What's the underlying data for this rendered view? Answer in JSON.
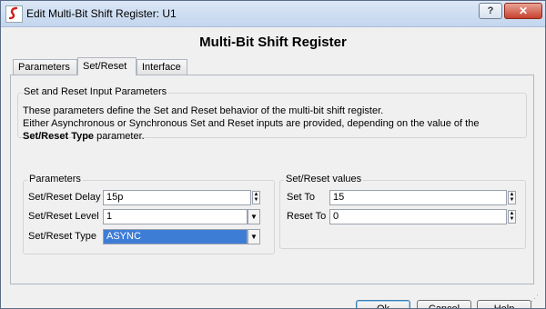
{
  "window": {
    "title": "Edit Multi-Bit Shift Register: U1",
    "help_label": "?",
    "close_label": "✕"
  },
  "heading": "Multi-Bit Shift Register",
  "tabs": [
    "Parameters",
    "Set/Reset",
    "Interface"
  ],
  "active_tab": "Set/Reset",
  "info": {
    "title": "Set and Reset Input Parameters",
    "line1": "These parameters define the Set and Reset behavior of the multi-bit shift register.",
    "line2_prefix": "Either Asynchronous or Synchronous Set and Reset inputs are provided, depending on the value of the ",
    "line2_bold": "Set/Reset Type",
    "line2_suffix": " parameter."
  },
  "parameters": {
    "title": "Parameters",
    "delay_label": "Set/Reset Delay",
    "delay_value": "15p",
    "level_label": "Set/Reset Level",
    "level_value": "1",
    "type_label": "Set/Reset Type",
    "type_value": "ASYNC"
  },
  "values": {
    "title": "Set/Reset values",
    "setto_label": "Set To",
    "setto_value": "15",
    "resetto_label": "Reset To",
    "resetto_value": "0"
  },
  "buttons": {
    "ok": "Ok",
    "cancel": "Cancel",
    "help": "Help"
  }
}
